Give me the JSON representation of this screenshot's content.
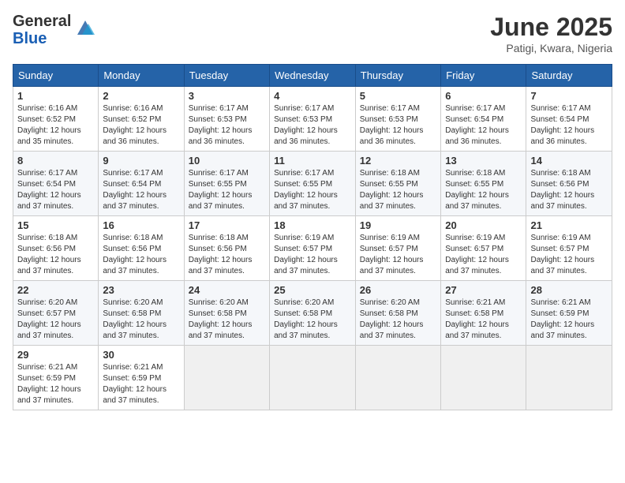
{
  "header": {
    "logo_general": "General",
    "logo_blue": "Blue",
    "month_title": "June 2025",
    "location": "Patigi, Kwara, Nigeria"
  },
  "weekdays": [
    "Sunday",
    "Monday",
    "Tuesday",
    "Wednesday",
    "Thursday",
    "Friday",
    "Saturday"
  ],
  "weeks": [
    [
      {
        "day": 1,
        "sunrise": "6:16 AM",
        "sunset": "6:52 PM",
        "daylight": "12 hours and 35 minutes."
      },
      {
        "day": 2,
        "sunrise": "6:16 AM",
        "sunset": "6:52 PM",
        "daylight": "12 hours and 36 minutes."
      },
      {
        "day": 3,
        "sunrise": "6:17 AM",
        "sunset": "6:53 PM",
        "daylight": "12 hours and 36 minutes."
      },
      {
        "day": 4,
        "sunrise": "6:17 AM",
        "sunset": "6:53 PM",
        "daylight": "12 hours and 36 minutes."
      },
      {
        "day": 5,
        "sunrise": "6:17 AM",
        "sunset": "6:53 PM",
        "daylight": "12 hours and 36 minutes."
      },
      {
        "day": 6,
        "sunrise": "6:17 AM",
        "sunset": "6:54 PM",
        "daylight": "12 hours and 36 minutes."
      },
      {
        "day": 7,
        "sunrise": "6:17 AM",
        "sunset": "6:54 PM",
        "daylight": "12 hours and 36 minutes."
      }
    ],
    [
      {
        "day": 8,
        "sunrise": "6:17 AM",
        "sunset": "6:54 PM",
        "daylight": "12 hours and 37 minutes."
      },
      {
        "day": 9,
        "sunrise": "6:17 AM",
        "sunset": "6:54 PM",
        "daylight": "12 hours and 37 minutes."
      },
      {
        "day": 10,
        "sunrise": "6:17 AM",
        "sunset": "6:55 PM",
        "daylight": "12 hours and 37 minutes."
      },
      {
        "day": 11,
        "sunrise": "6:17 AM",
        "sunset": "6:55 PM",
        "daylight": "12 hours and 37 minutes."
      },
      {
        "day": 12,
        "sunrise": "6:18 AM",
        "sunset": "6:55 PM",
        "daylight": "12 hours and 37 minutes."
      },
      {
        "day": 13,
        "sunrise": "6:18 AM",
        "sunset": "6:55 PM",
        "daylight": "12 hours and 37 minutes."
      },
      {
        "day": 14,
        "sunrise": "6:18 AM",
        "sunset": "6:56 PM",
        "daylight": "12 hours and 37 minutes."
      }
    ],
    [
      {
        "day": 15,
        "sunrise": "6:18 AM",
        "sunset": "6:56 PM",
        "daylight": "12 hours and 37 minutes."
      },
      {
        "day": 16,
        "sunrise": "6:18 AM",
        "sunset": "6:56 PM",
        "daylight": "12 hours and 37 minutes."
      },
      {
        "day": 17,
        "sunrise": "6:18 AM",
        "sunset": "6:56 PM",
        "daylight": "12 hours and 37 minutes."
      },
      {
        "day": 18,
        "sunrise": "6:19 AM",
        "sunset": "6:57 PM",
        "daylight": "12 hours and 37 minutes."
      },
      {
        "day": 19,
        "sunrise": "6:19 AM",
        "sunset": "6:57 PM",
        "daylight": "12 hours and 37 minutes."
      },
      {
        "day": 20,
        "sunrise": "6:19 AM",
        "sunset": "6:57 PM",
        "daylight": "12 hours and 37 minutes."
      },
      {
        "day": 21,
        "sunrise": "6:19 AM",
        "sunset": "6:57 PM",
        "daylight": "12 hours and 37 minutes."
      }
    ],
    [
      {
        "day": 22,
        "sunrise": "6:20 AM",
        "sunset": "6:57 PM",
        "daylight": "12 hours and 37 minutes."
      },
      {
        "day": 23,
        "sunrise": "6:20 AM",
        "sunset": "6:58 PM",
        "daylight": "12 hours and 37 minutes."
      },
      {
        "day": 24,
        "sunrise": "6:20 AM",
        "sunset": "6:58 PM",
        "daylight": "12 hours and 37 minutes."
      },
      {
        "day": 25,
        "sunrise": "6:20 AM",
        "sunset": "6:58 PM",
        "daylight": "12 hours and 37 minutes."
      },
      {
        "day": 26,
        "sunrise": "6:20 AM",
        "sunset": "6:58 PM",
        "daylight": "12 hours and 37 minutes."
      },
      {
        "day": 27,
        "sunrise": "6:21 AM",
        "sunset": "6:58 PM",
        "daylight": "12 hours and 37 minutes."
      },
      {
        "day": 28,
        "sunrise": "6:21 AM",
        "sunset": "6:59 PM",
        "daylight": "12 hours and 37 minutes."
      }
    ],
    [
      {
        "day": 29,
        "sunrise": "6:21 AM",
        "sunset": "6:59 PM",
        "daylight": "12 hours and 37 minutes."
      },
      {
        "day": 30,
        "sunrise": "6:21 AM",
        "sunset": "6:59 PM",
        "daylight": "12 hours and 37 minutes."
      },
      null,
      null,
      null,
      null,
      null
    ]
  ]
}
